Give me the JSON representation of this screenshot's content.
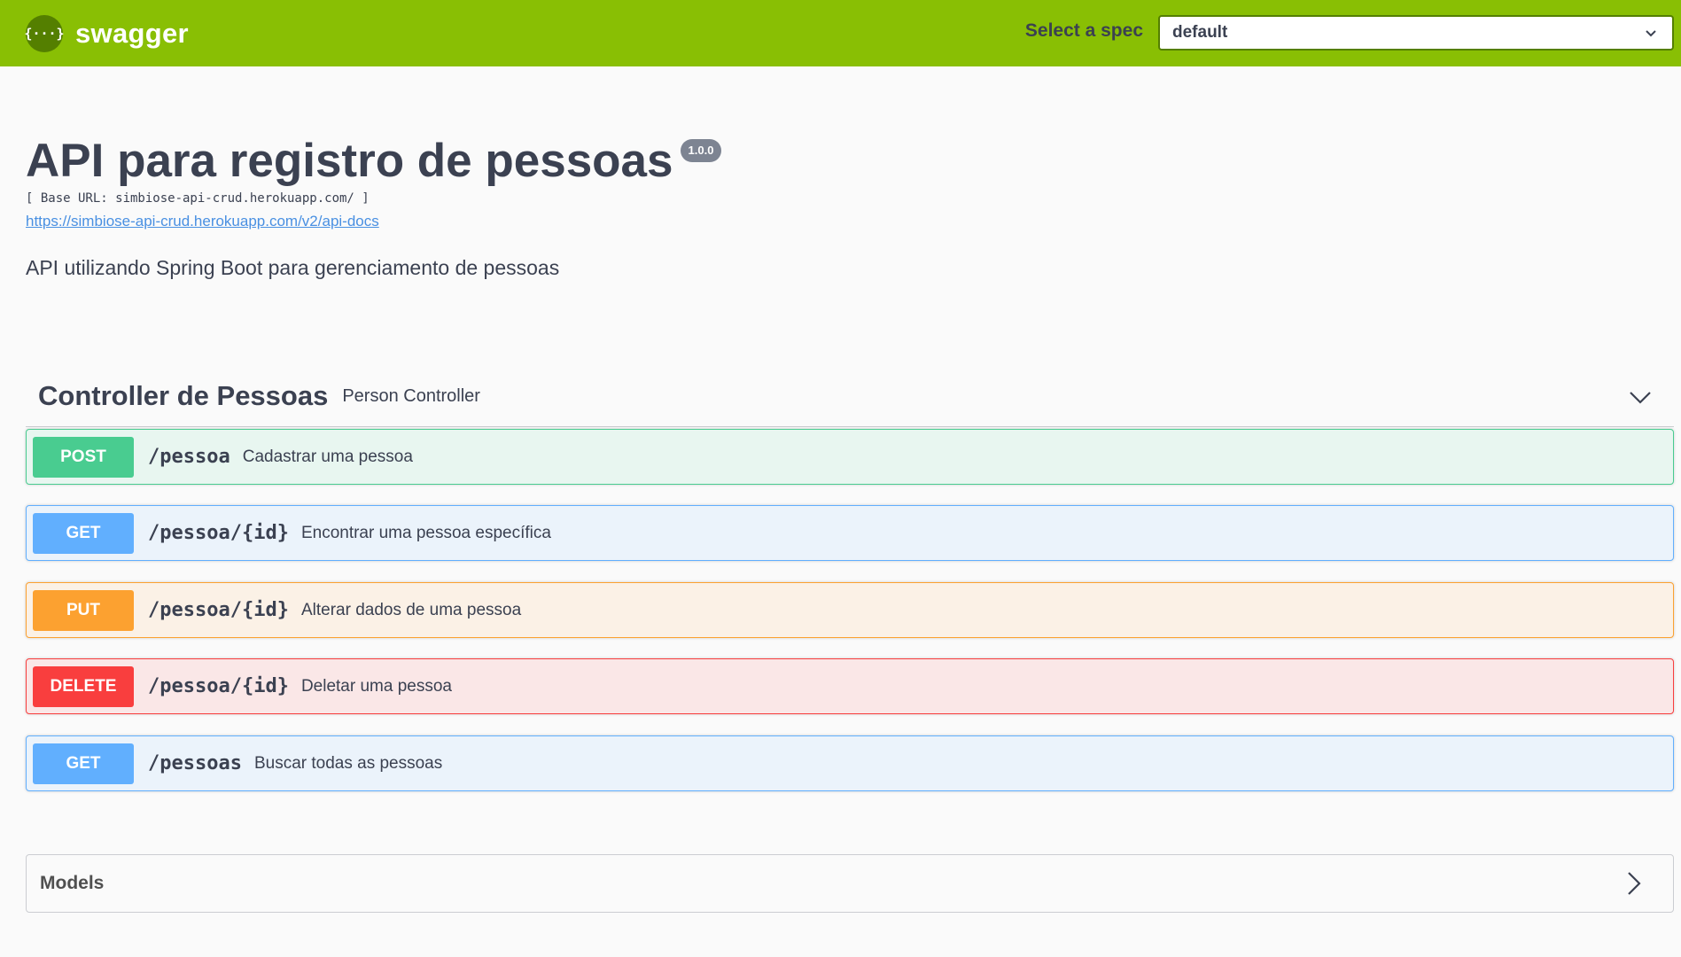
{
  "topbar": {
    "logo_glyph": "{···}",
    "logo_text": "swagger",
    "spec_label": "Select a spec",
    "spec_value": "default",
    "colors": {
      "bar": "#89bf04",
      "logo": "#547f00"
    }
  },
  "info": {
    "title": "API para registro de pessoas",
    "version": "1.0.0",
    "base_url": "[ Base URL: simbiose-api-crud.herokuapp.com/ ]",
    "api_docs_link": "https://simbiose-api-crud.herokuapp.com/v2/api-docs",
    "description": "API utilizando Spring Boot para gerenciamento de pessoas"
  },
  "tag": {
    "name": "Controller de Pessoas",
    "description": "Person Controller",
    "icon": "chevron-down-icon"
  },
  "operations": [
    {
      "method": "POST",
      "path": "/pessoa",
      "summary": "Cadastrar uma pessoa",
      "color": "#49cc90"
    },
    {
      "method": "GET",
      "path": "/pessoa/{id}",
      "summary": "Encontrar uma pessoa específica",
      "color": "#61affe"
    },
    {
      "method": "PUT",
      "path": "/pessoa/{id}",
      "summary": "Alterar dados de uma pessoa",
      "color": "#fca130"
    },
    {
      "method": "DELETE",
      "path": "/pessoa/{id}",
      "summary": "Deletar uma pessoa",
      "color": "#f93e3e"
    },
    {
      "method": "GET",
      "path": "/pessoas",
      "summary": "Buscar todas as pessoas",
      "color": "#61affe"
    }
  ],
  "models": {
    "title": "Models",
    "icon": "chevron-right-icon"
  }
}
